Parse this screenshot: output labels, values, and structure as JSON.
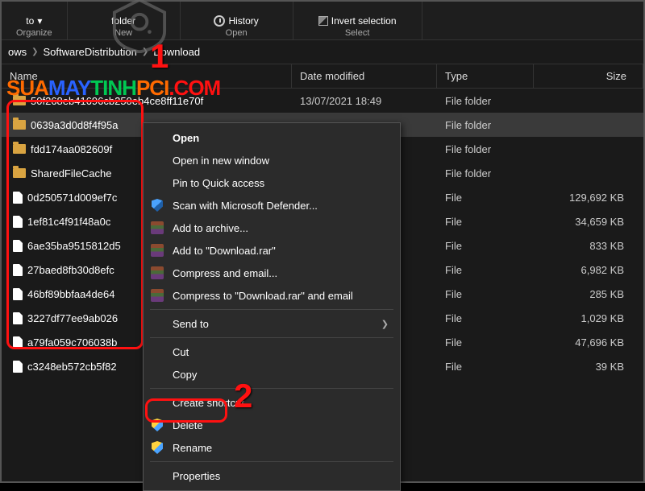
{
  "ribbon": {
    "groups": [
      {
        "label": "Organize",
        "items": [
          {
            "label": "to",
            "dropdown": true
          }
        ]
      },
      {
        "label": "New",
        "items": [
          {
            "label": "folder"
          }
        ]
      },
      {
        "label": "Open",
        "items": [
          {
            "label": "History",
            "icon": "history"
          }
        ]
      },
      {
        "label": "Select",
        "items": [
          {
            "label": "Invert selection",
            "icon": "invert"
          }
        ]
      }
    ]
  },
  "breadcrumb": [
    "ows",
    "SoftwareDistribution",
    "Download"
  ],
  "columns": {
    "name": "Name",
    "date": "Date modified",
    "type": "Type",
    "size": "Size"
  },
  "files": [
    {
      "name": "50f268eb41696cb250eb4ce8ff11e70f",
      "icon": "folder",
      "date": "13/07/2021 18:49",
      "type": "File folder",
      "size": "",
      "sel": false
    },
    {
      "name": "0639a3d0d8f4f95a",
      "icon": "folder",
      "date": "",
      "type": "File folder",
      "size": "",
      "sel": true
    },
    {
      "name": "fdd174aa082609f",
      "icon": "folder",
      "date": "",
      "type": "File folder",
      "size": "",
      "sel": false
    },
    {
      "name": "SharedFileCache",
      "icon": "folder",
      "date": "",
      "type": "File folder",
      "size": "",
      "sel": false
    },
    {
      "name": "0d250571d009ef7c",
      "icon": "file",
      "date": "",
      "type": "File",
      "size": "129,692 KB",
      "sel": false
    },
    {
      "name": "1ef81c4f91f48a0c",
      "icon": "file",
      "date": "",
      "type": "File",
      "size": "34,659 KB",
      "sel": false
    },
    {
      "name": "6ae35ba9515812d5",
      "icon": "file",
      "date": "",
      "type": "File",
      "size": "833 KB",
      "sel": false
    },
    {
      "name": "27baed8fb30d8efc",
      "icon": "file",
      "date": "",
      "type": "File",
      "size": "6,982 KB",
      "sel": false
    },
    {
      "name": "46bf89bbfaa4de64",
      "icon": "file",
      "date": "",
      "type": "File",
      "size": "285 KB",
      "sel": false
    },
    {
      "name": "3227df77ee9ab026",
      "icon": "file",
      "date": "",
      "type": "File",
      "size": "1,029 KB",
      "sel": false
    },
    {
      "name": "a79fa059c706038b",
      "icon": "file",
      "date": "",
      "type": "File",
      "size": "47,696 KB",
      "sel": false
    },
    {
      "name": "c3248eb572cb5f82",
      "icon": "file",
      "date": "",
      "type": "File",
      "size": "39 KB",
      "sel": false
    }
  ],
  "context_menu": [
    {
      "type": "item",
      "label": "Open",
      "bold": true
    },
    {
      "type": "item",
      "label": "Open in new window"
    },
    {
      "type": "item",
      "label": "Pin to Quick access"
    },
    {
      "type": "item",
      "label": "Scan with Microsoft Defender...",
      "icon": "shield-blue"
    },
    {
      "type": "item",
      "label": "Add to archive...",
      "icon": "rar"
    },
    {
      "type": "item",
      "label": "Add to \"Download.rar\"",
      "icon": "rar"
    },
    {
      "type": "item",
      "label": "Compress and email...",
      "icon": "rar"
    },
    {
      "type": "item",
      "label": "Compress to \"Download.rar\" and email",
      "icon": "rar"
    },
    {
      "type": "sep"
    },
    {
      "type": "item",
      "label": "Send to",
      "arrow": true
    },
    {
      "type": "sep"
    },
    {
      "type": "item",
      "label": "Cut"
    },
    {
      "type": "item",
      "label": "Copy"
    },
    {
      "type": "sep"
    },
    {
      "type": "item",
      "label": "Create shortcut"
    },
    {
      "type": "item",
      "label": "Delete",
      "icon": "shield-yb"
    },
    {
      "type": "item",
      "label": "Rename",
      "icon": "shield-yb"
    },
    {
      "type": "sep"
    },
    {
      "type": "item",
      "label": "Properties"
    }
  ],
  "annotations": {
    "num1": "1",
    "num2": "2",
    "watermark": {
      "p1": "SUA",
      "p2": "MAY",
      "p3": "TINH",
      "p4": "PCI",
      "p5": ".COM"
    }
  }
}
